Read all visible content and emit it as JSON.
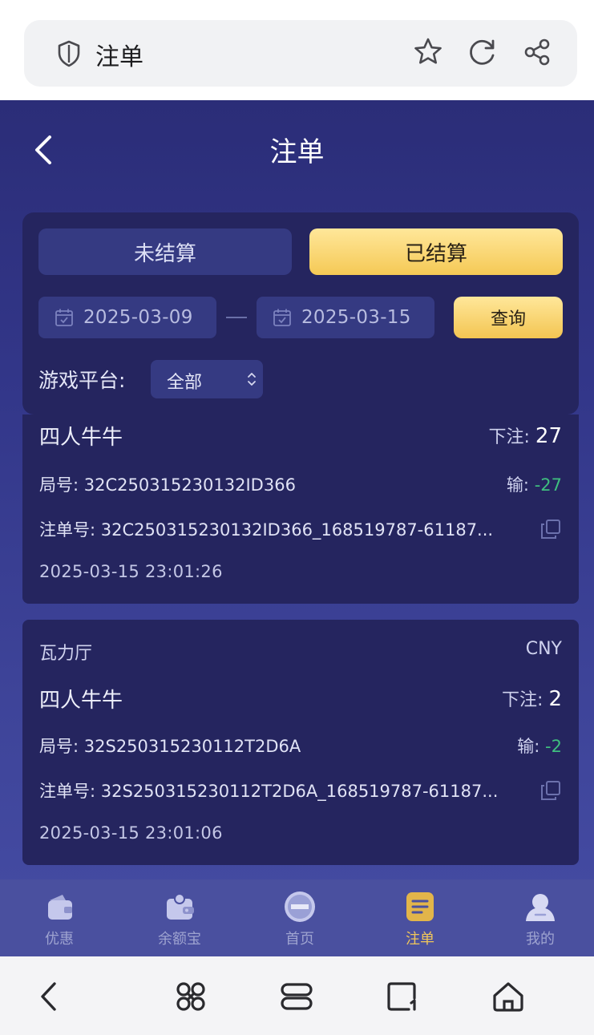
{
  "browser": {
    "tab_title": "注单"
  },
  "header": {
    "title": "注单"
  },
  "filters": {
    "tab_unsettled": "未结算",
    "tab_settled": "已结算",
    "start_date": "2025-03-09",
    "end_date": "2025-03-15",
    "query_label": "查询",
    "platform_label": "游戏平台:",
    "platform_value": "全部"
  },
  "records": [
    {
      "provider": "",
      "currency": "",
      "game": "四人牛牛",
      "bet_label": "下注:",
      "bet_value": "27",
      "round_label": "局号:",
      "round_id": "32C250315230132ID366",
      "result_label": "输:",
      "result_value": "-27",
      "order_label": "注单号:",
      "order_id": "32C250315230132ID366_168519787-61187...",
      "time": "2025-03-15 23:01:26"
    },
    {
      "provider": "瓦力厅",
      "currency": "CNY",
      "game": "四人牛牛",
      "bet_label": "下注:",
      "bet_value": "2",
      "round_label": "局号:",
      "round_id": "32S250315230112T2D6A",
      "result_label": "输:",
      "result_value": "-2",
      "order_label": "注单号:",
      "order_id": "32S250315230112T2D6A_168519787-61187...",
      "time": "2025-03-15 23:01:06"
    }
  ],
  "tabbar": {
    "items": [
      {
        "label": "优惠",
        "icon": "wallet-icon"
      },
      {
        "label": "余额宝",
        "icon": "balance-treasure-icon"
      },
      {
        "label": "首页",
        "icon": "home-logo-icon"
      },
      {
        "label": "注单",
        "icon": "bet-record-icon"
      },
      {
        "label": "我的",
        "icon": "profile-icon"
      }
    ],
    "active_index": 3
  },
  "colors": {
    "accent_gold": "#f5c955",
    "loss_green": "#3fbf7f",
    "card_bg": "#25255f"
  }
}
